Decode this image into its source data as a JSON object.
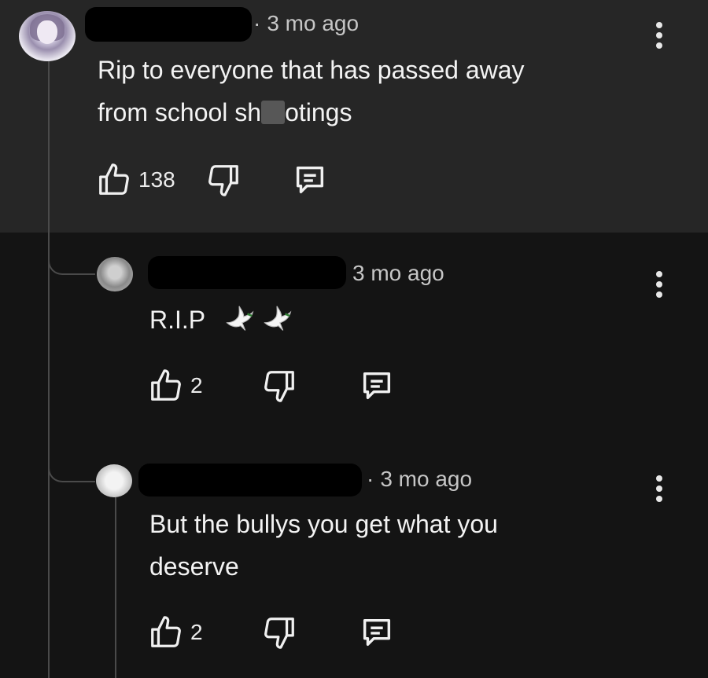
{
  "comments": [
    {
      "time": "3 mo ago",
      "dot": "·",
      "text_part1": "Rip to everyone that has passed away",
      "text_part2_a": "from school sh",
      "text_part2_b": "otings",
      "likes": "138"
    },
    {
      "time": "3 mo ago",
      "text": "R.I.P",
      "emoji": "dove-icon x2",
      "likes": "2"
    },
    {
      "time": "3 mo ago",
      "dot": "·",
      "text_line1": "But the bullys you get what you",
      "text_line2": "deserve",
      "likes": "2"
    }
  ],
  "colors": {
    "top_band": "#262626",
    "background": "#141414",
    "thread_line": "#4a4a4a"
  }
}
